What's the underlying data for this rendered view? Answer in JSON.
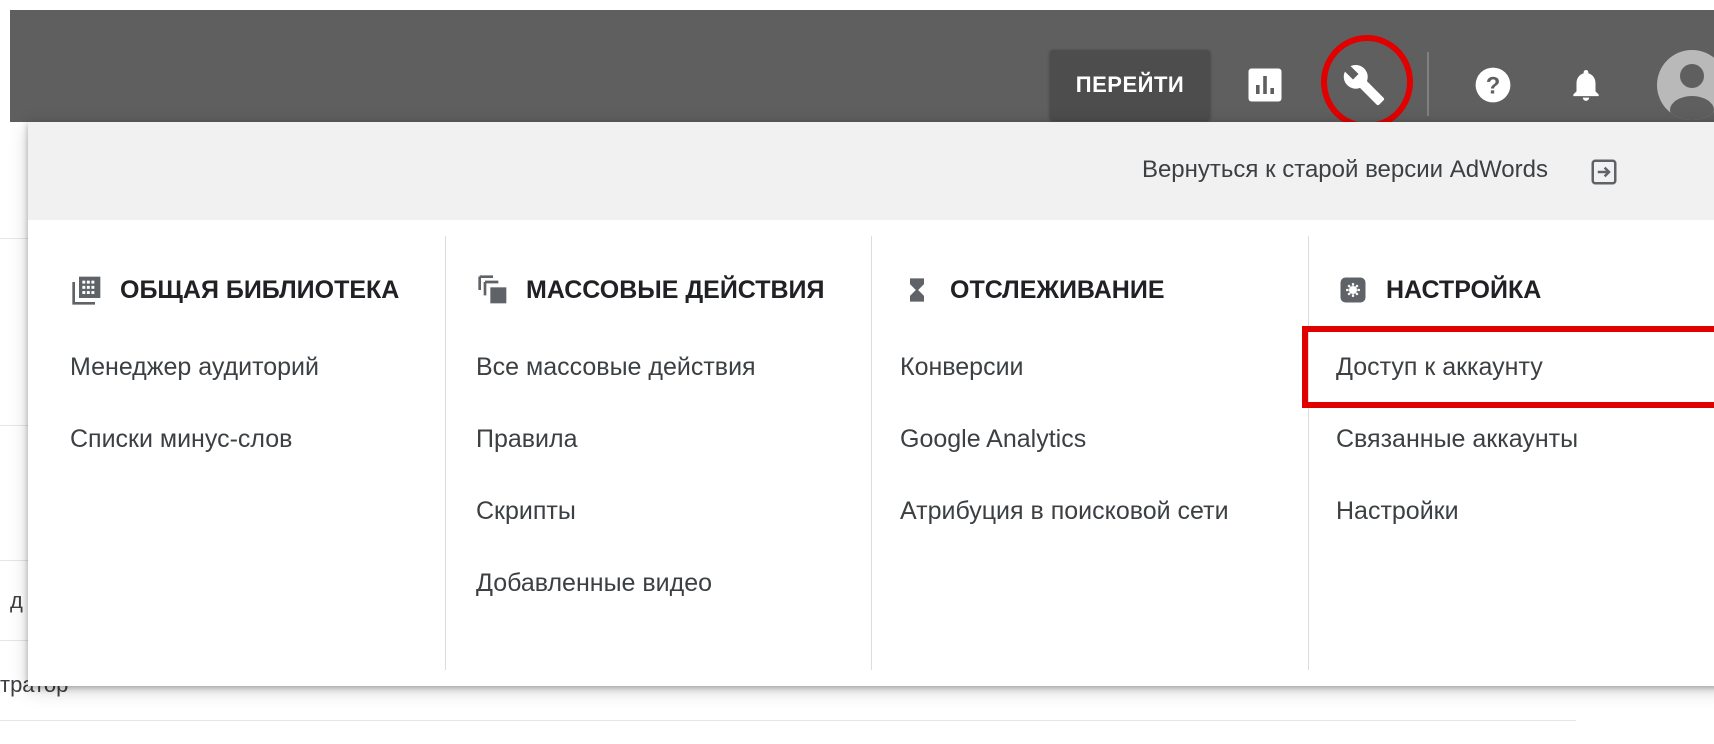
{
  "header": {
    "goto_label": "ПЕРЕЙТИ",
    "icons": [
      "reports-icon",
      "tools-icon",
      "help-icon",
      "notifications-bell-icon",
      "account-avatar"
    ]
  },
  "background": {
    "text_1": "д",
    "text_2": "тратор"
  },
  "menu": {
    "return_link": "Вернуться к старой версии AdWords",
    "columns": [
      {
        "title": "ОБЩАЯ БИБЛИОТЕКА",
        "icon": "library-icon",
        "items": [
          "Менеджер аудиторий",
          "Списки минус-слов"
        ]
      },
      {
        "title": "МАССОВЫЕ ДЕЙСТВИЯ",
        "icon": "bulk-actions-icon",
        "items": [
          "Все массовые действия",
          "Правила",
          "Скрипты",
          "Добавленные видео"
        ]
      },
      {
        "title": "ОТСЛЕЖИВАНИЕ",
        "icon": "hourglass-icon",
        "items": [
          "Конверсии",
          "Google Analytics",
          "Атрибуция в поисковой сети"
        ]
      },
      {
        "title": "НАСТРОЙКА",
        "icon": "settings-gear-icon",
        "items": [
          "Доступ к аккаунту",
          "Связанные аккаунты",
          "Настройки"
        ]
      }
    ]
  },
  "colors": {
    "header_bg": "#5f5f5f",
    "highlight": "#e00000",
    "panel_top_bg": "#f1f1f1"
  }
}
